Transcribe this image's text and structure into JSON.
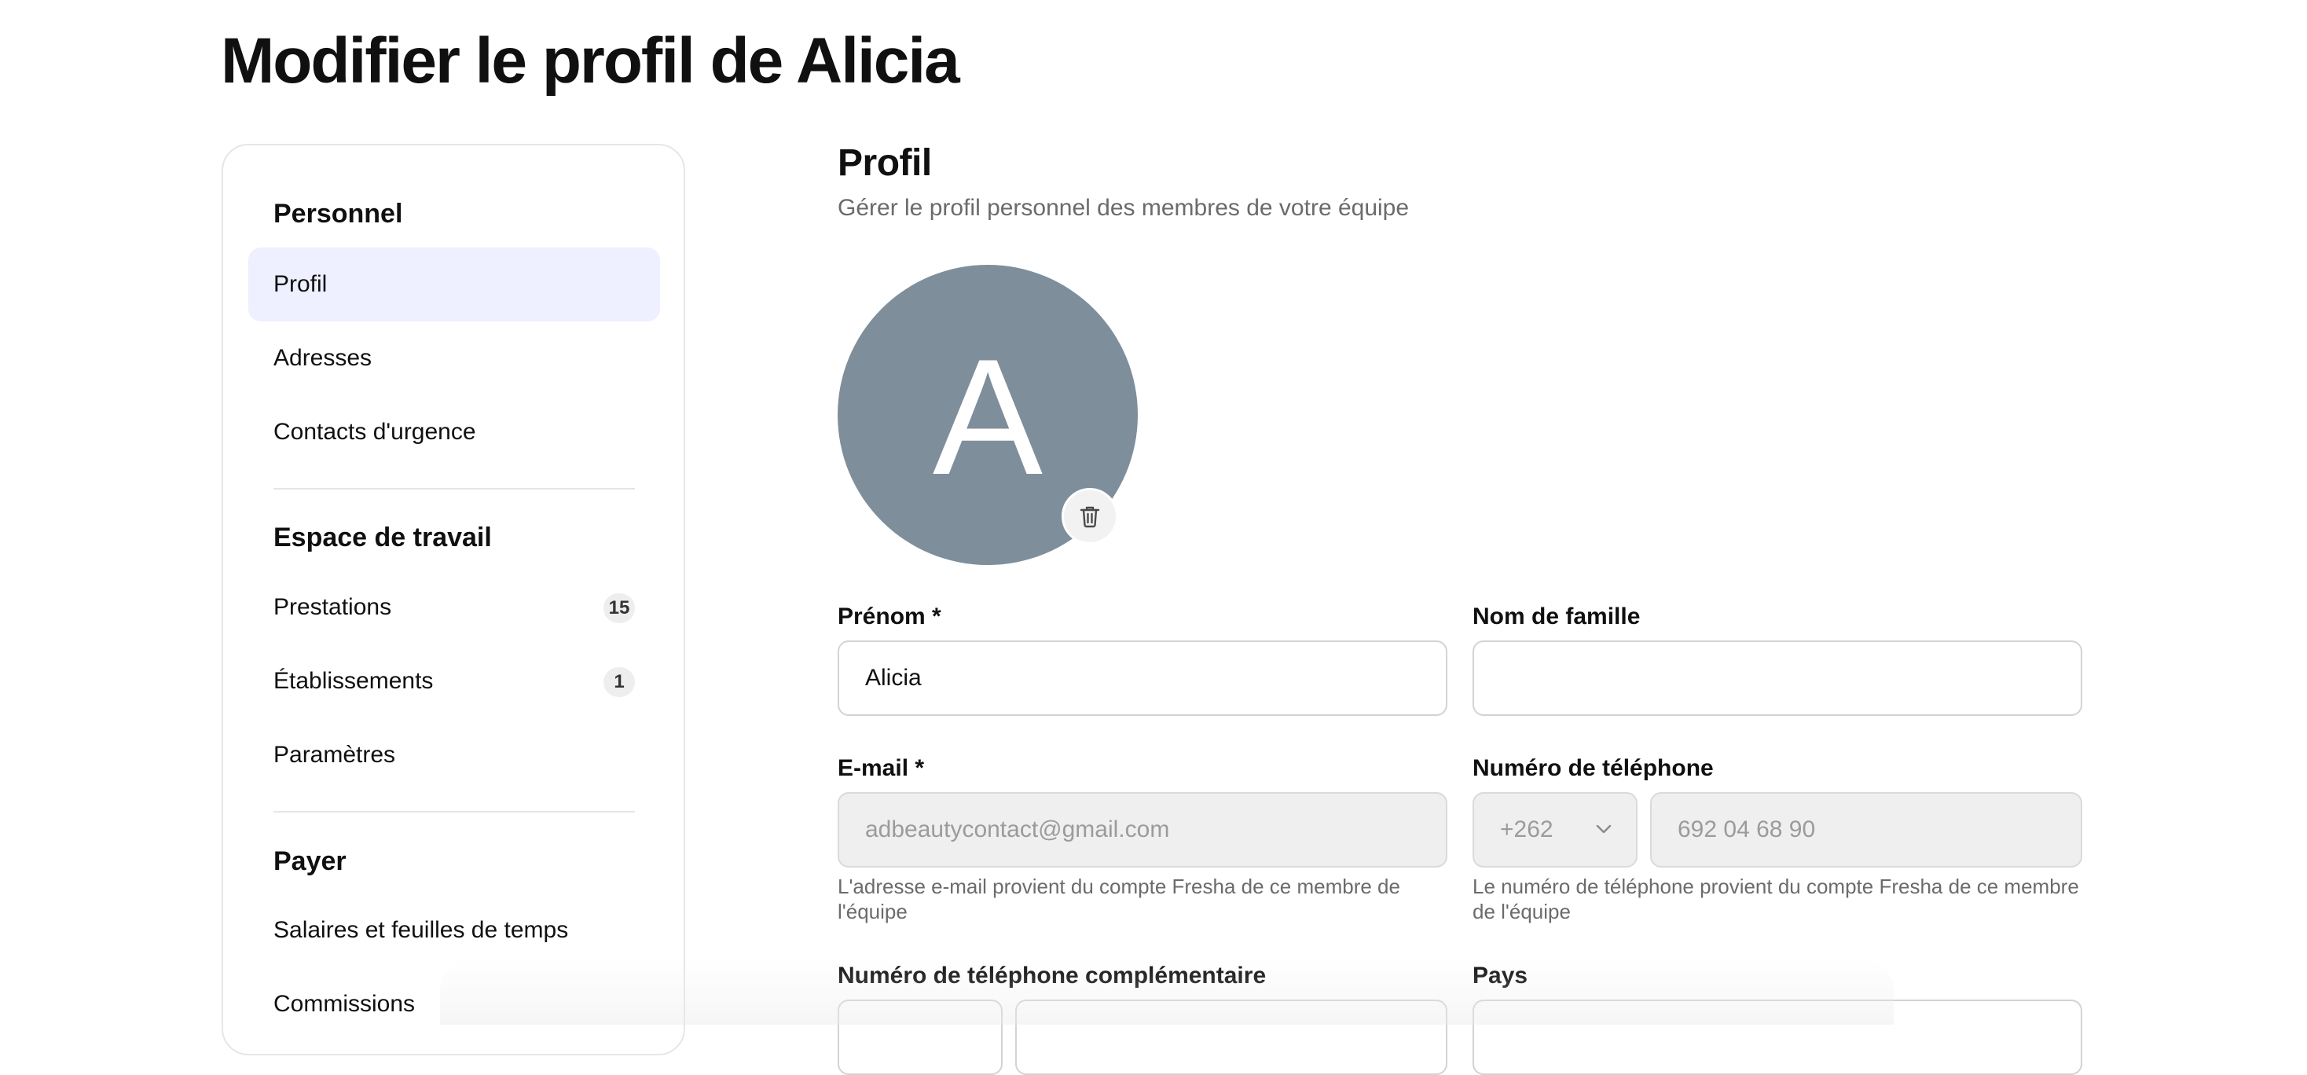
{
  "page": {
    "title": "Modifier le profil de Alicia"
  },
  "sidebar": {
    "sections": [
      {
        "heading": "Personnel",
        "items": [
          {
            "label": "Profil",
            "active": true
          },
          {
            "label": "Adresses"
          },
          {
            "label": "Contacts d'urgence"
          }
        ]
      },
      {
        "heading": "Espace de travail",
        "items": [
          {
            "label": "Prestations",
            "badge": "15"
          },
          {
            "label": "Établissements",
            "badge": "1"
          },
          {
            "label": "Paramètres"
          }
        ]
      },
      {
        "heading": "Payer",
        "items": [
          {
            "label": "Salaires et feuilles de temps"
          },
          {
            "label": "Commissions"
          }
        ]
      }
    ]
  },
  "profile": {
    "title": "Profil",
    "subtitle": "Gérer le profil personnel des membres de votre équipe",
    "avatar_letter": "A",
    "avatar_color": "#7f8e9b",
    "delete_icon": "trash-icon"
  },
  "form": {
    "first_name": {
      "label": "Prénom *",
      "value": "Alicia"
    },
    "last_name": {
      "label": "Nom de famille",
      "value": ""
    },
    "email": {
      "label": "E-mail *",
      "value": "adbeautycontact@gmail.com",
      "helper": "L'adresse e-mail provient du compte Fresha de ce membre de l'équipe"
    },
    "phone": {
      "label": "Numéro de téléphone",
      "country_code": "+262",
      "value": "692 04 68 90",
      "helper": "Le numéro de téléphone provient du compte Fresha de ce membre de l'équipe"
    },
    "extra_phone": {
      "label": "Numéro de téléphone complémentaire"
    },
    "country": {
      "label": "Pays"
    }
  },
  "colors": {
    "active_nav_bg": "#eeefff",
    "accent": "#101010"
  }
}
